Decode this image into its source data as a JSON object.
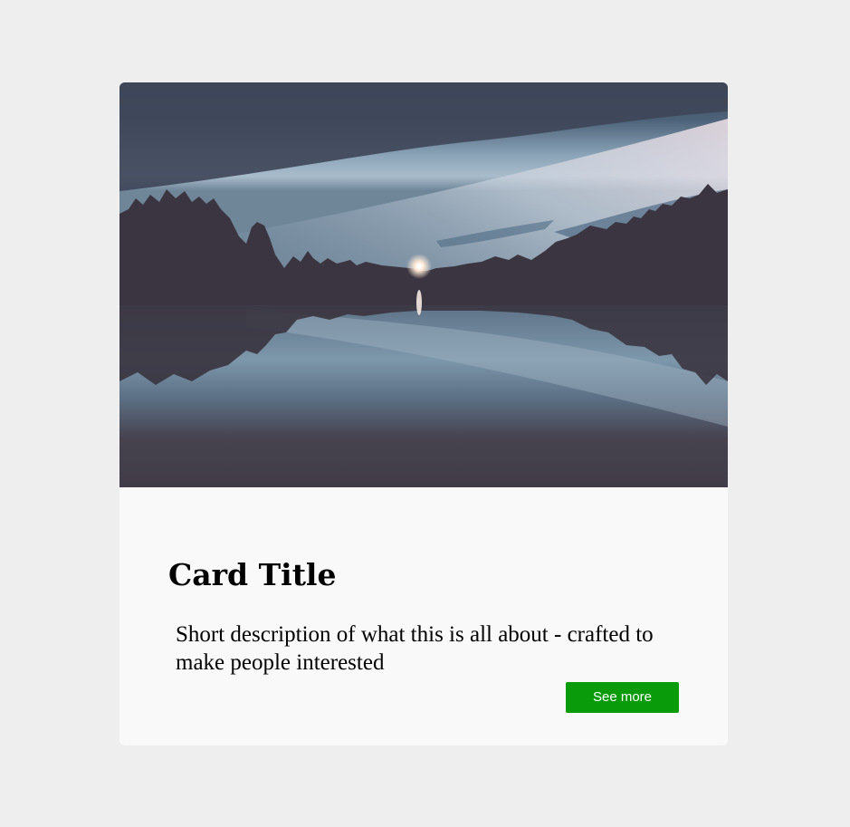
{
  "card": {
    "image": "lake at dusk with tree silhouettes and a distant light reflected in the water",
    "title": "Card Title",
    "description": "Short description of what this is all about - crafted to make people interested",
    "button_label": "See more"
  },
  "colors": {
    "page_background": "#eeeeee",
    "card_background": "#f9f9f9",
    "button_background": "#0a9b0a",
    "button_text": "#ffffff"
  }
}
